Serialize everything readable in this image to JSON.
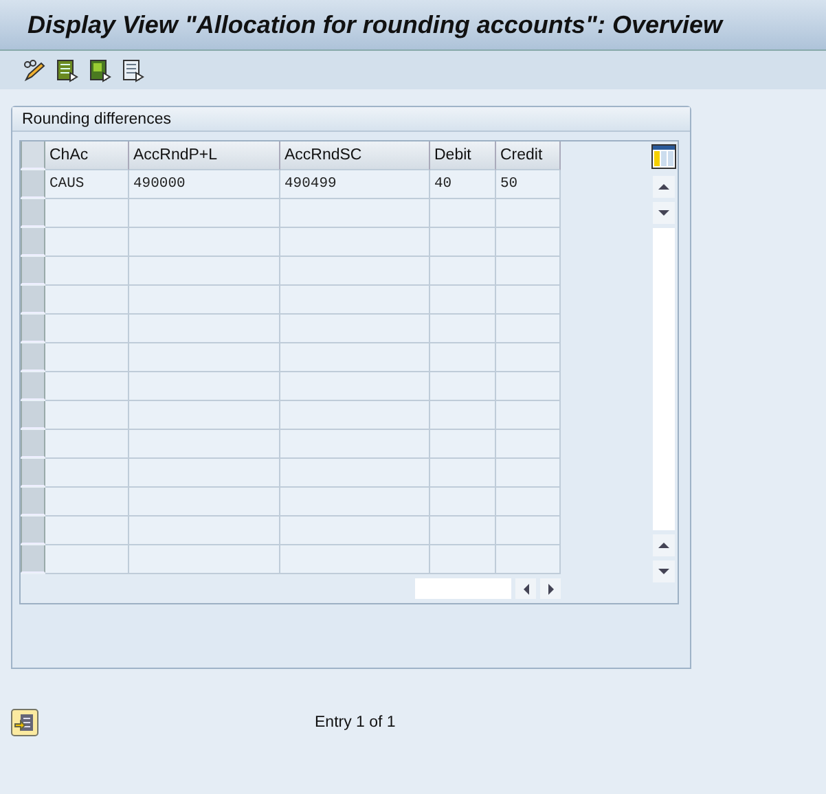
{
  "window": {
    "title": "Display View \"Allocation for rounding accounts\": Overview"
  },
  "group": {
    "title": "Rounding differences"
  },
  "table": {
    "columns": [
      "ChAc",
      "AccRndP+L",
      "AccRndSC",
      "Debit",
      "Credit"
    ],
    "rows": [
      {
        "cells": [
          "CAUS",
          "490000",
          "490499",
          "40",
          "50"
        ],
        "selected": false
      }
    ]
  },
  "status": {
    "text": "Entry 1 of 1"
  }
}
